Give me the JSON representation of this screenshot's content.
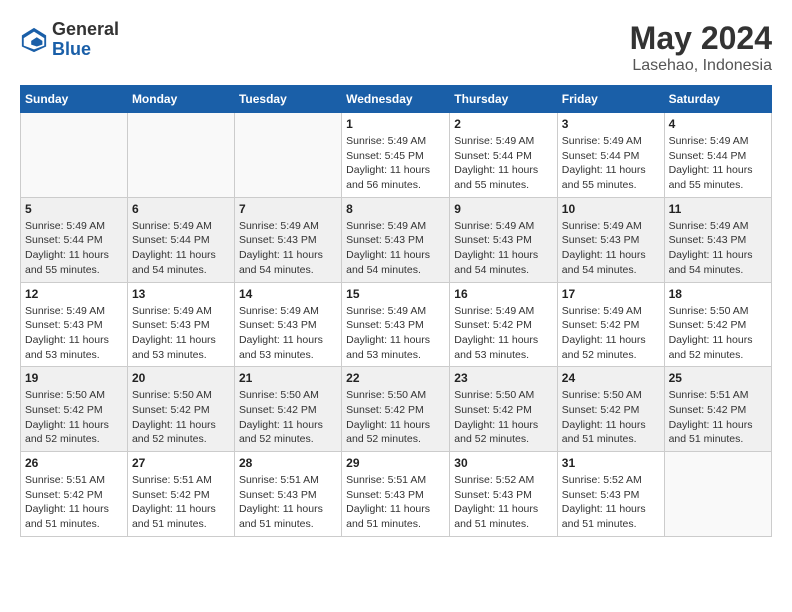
{
  "header": {
    "logo_general": "General",
    "logo_blue": "Blue",
    "title": "May 2024",
    "location": "Lasehao, Indonesia"
  },
  "days_of_week": [
    "Sunday",
    "Monday",
    "Tuesday",
    "Wednesday",
    "Thursday",
    "Friday",
    "Saturday"
  ],
  "weeks": [
    {
      "shaded": false,
      "days": [
        {
          "num": "",
          "info": ""
        },
        {
          "num": "",
          "info": ""
        },
        {
          "num": "",
          "info": ""
        },
        {
          "num": "1",
          "info": "Sunrise: 5:49 AM\nSunset: 5:45 PM\nDaylight: 11 hours and 56 minutes."
        },
        {
          "num": "2",
          "info": "Sunrise: 5:49 AM\nSunset: 5:44 PM\nDaylight: 11 hours and 55 minutes."
        },
        {
          "num": "3",
          "info": "Sunrise: 5:49 AM\nSunset: 5:44 PM\nDaylight: 11 hours and 55 minutes."
        },
        {
          "num": "4",
          "info": "Sunrise: 5:49 AM\nSunset: 5:44 PM\nDaylight: 11 hours and 55 minutes."
        }
      ]
    },
    {
      "shaded": true,
      "days": [
        {
          "num": "5",
          "info": "Sunrise: 5:49 AM\nSunset: 5:44 PM\nDaylight: 11 hours and 55 minutes."
        },
        {
          "num": "6",
          "info": "Sunrise: 5:49 AM\nSunset: 5:44 PM\nDaylight: 11 hours and 54 minutes."
        },
        {
          "num": "7",
          "info": "Sunrise: 5:49 AM\nSunset: 5:43 PM\nDaylight: 11 hours and 54 minutes."
        },
        {
          "num": "8",
          "info": "Sunrise: 5:49 AM\nSunset: 5:43 PM\nDaylight: 11 hours and 54 minutes."
        },
        {
          "num": "9",
          "info": "Sunrise: 5:49 AM\nSunset: 5:43 PM\nDaylight: 11 hours and 54 minutes."
        },
        {
          "num": "10",
          "info": "Sunrise: 5:49 AM\nSunset: 5:43 PM\nDaylight: 11 hours and 54 minutes."
        },
        {
          "num": "11",
          "info": "Sunrise: 5:49 AM\nSunset: 5:43 PM\nDaylight: 11 hours and 54 minutes."
        }
      ]
    },
    {
      "shaded": false,
      "days": [
        {
          "num": "12",
          "info": "Sunrise: 5:49 AM\nSunset: 5:43 PM\nDaylight: 11 hours and 53 minutes."
        },
        {
          "num": "13",
          "info": "Sunrise: 5:49 AM\nSunset: 5:43 PM\nDaylight: 11 hours and 53 minutes."
        },
        {
          "num": "14",
          "info": "Sunrise: 5:49 AM\nSunset: 5:43 PM\nDaylight: 11 hours and 53 minutes."
        },
        {
          "num": "15",
          "info": "Sunrise: 5:49 AM\nSunset: 5:43 PM\nDaylight: 11 hours and 53 minutes."
        },
        {
          "num": "16",
          "info": "Sunrise: 5:49 AM\nSunset: 5:42 PM\nDaylight: 11 hours and 53 minutes."
        },
        {
          "num": "17",
          "info": "Sunrise: 5:49 AM\nSunset: 5:42 PM\nDaylight: 11 hours and 52 minutes."
        },
        {
          "num": "18",
          "info": "Sunrise: 5:50 AM\nSunset: 5:42 PM\nDaylight: 11 hours and 52 minutes."
        }
      ]
    },
    {
      "shaded": true,
      "days": [
        {
          "num": "19",
          "info": "Sunrise: 5:50 AM\nSunset: 5:42 PM\nDaylight: 11 hours and 52 minutes."
        },
        {
          "num": "20",
          "info": "Sunrise: 5:50 AM\nSunset: 5:42 PM\nDaylight: 11 hours and 52 minutes."
        },
        {
          "num": "21",
          "info": "Sunrise: 5:50 AM\nSunset: 5:42 PM\nDaylight: 11 hours and 52 minutes."
        },
        {
          "num": "22",
          "info": "Sunrise: 5:50 AM\nSunset: 5:42 PM\nDaylight: 11 hours and 52 minutes."
        },
        {
          "num": "23",
          "info": "Sunrise: 5:50 AM\nSunset: 5:42 PM\nDaylight: 11 hours and 52 minutes."
        },
        {
          "num": "24",
          "info": "Sunrise: 5:50 AM\nSunset: 5:42 PM\nDaylight: 11 hours and 51 minutes."
        },
        {
          "num": "25",
          "info": "Sunrise: 5:51 AM\nSunset: 5:42 PM\nDaylight: 11 hours and 51 minutes."
        }
      ]
    },
    {
      "shaded": false,
      "days": [
        {
          "num": "26",
          "info": "Sunrise: 5:51 AM\nSunset: 5:42 PM\nDaylight: 11 hours and 51 minutes."
        },
        {
          "num": "27",
          "info": "Sunrise: 5:51 AM\nSunset: 5:42 PM\nDaylight: 11 hours and 51 minutes."
        },
        {
          "num": "28",
          "info": "Sunrise: 5:51 AM\nSunset: 5:43 PM\nDaylight: 11 hours and 51 minutes."
        },
        {
          "num": "29",
          "info": "Sunrise: 5:51 AM\nSunset: 5:43 PM\nDaylight: 11 hours and 51 minutes."
        },
        {
          "num": "30",
          "info": "Sunrise: 5:52 AM\nSunset: 5:43 PM\nDaylight: 11 hours and 51 minutes."
        },
        {
          "num": "31",
          "info": "Sunrise: 5:52 AM\nSunset: 5:43 PM\nDaylight: 11 hours and 51 minutes."
        },
        {
          "num": "",
          "info": ""
        }
      ]
    }
  ]
}
